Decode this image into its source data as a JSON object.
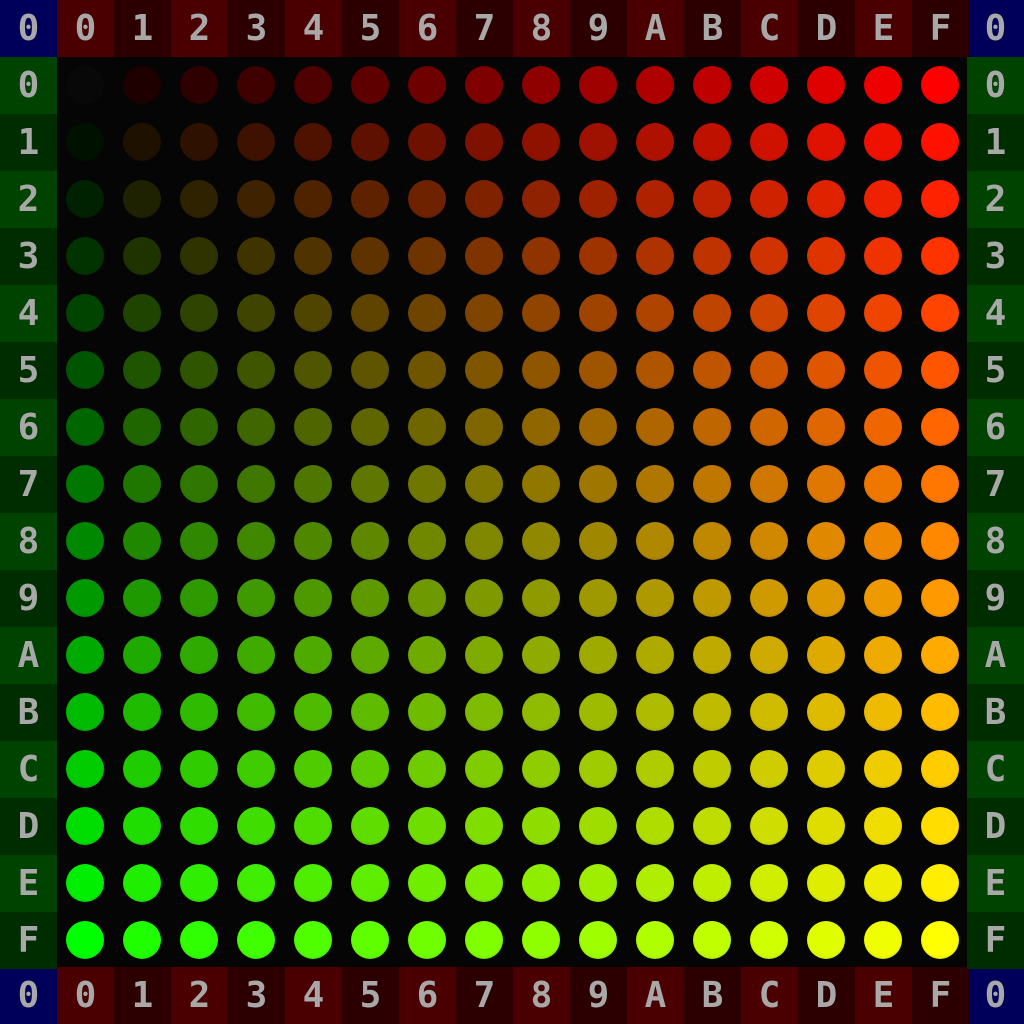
{
  "corner_label": "0",
  "column_labels": [
    "0",
    "1",
    "2",
    "3",
    "4",
    "5",
    "6",
    "7",
    "8",
    "9",
    "A",
    "B",
    "C",
    "D",
    "E",
    "F"
  ],
  "row_labels": [
    "0",
    "1",
    "2",
    "3",
    "4",
    "5",
    "6",
    "7",
    "8",
    "9",
    "A",
    "B",
    "C",
    "D",
    "E",
    "F"
  ],
  "colors": {
    "corner_bg": "#00005a",
    "column_header_bg": [
      "#4a0000",
      "#2c0000"
    ],
    "row_header_bg": [
      "#004300",
      "#002d00"
    ],
    "label_text": "#a8a8a8",
    "matrix_bg": "#050505"
  },
  "led_grid": {
    "red_scale": "red channel = (column + 1) * 16 - 1, column 0 = 0",
    "green_scale": "green channel = row * 17"
  }
}
